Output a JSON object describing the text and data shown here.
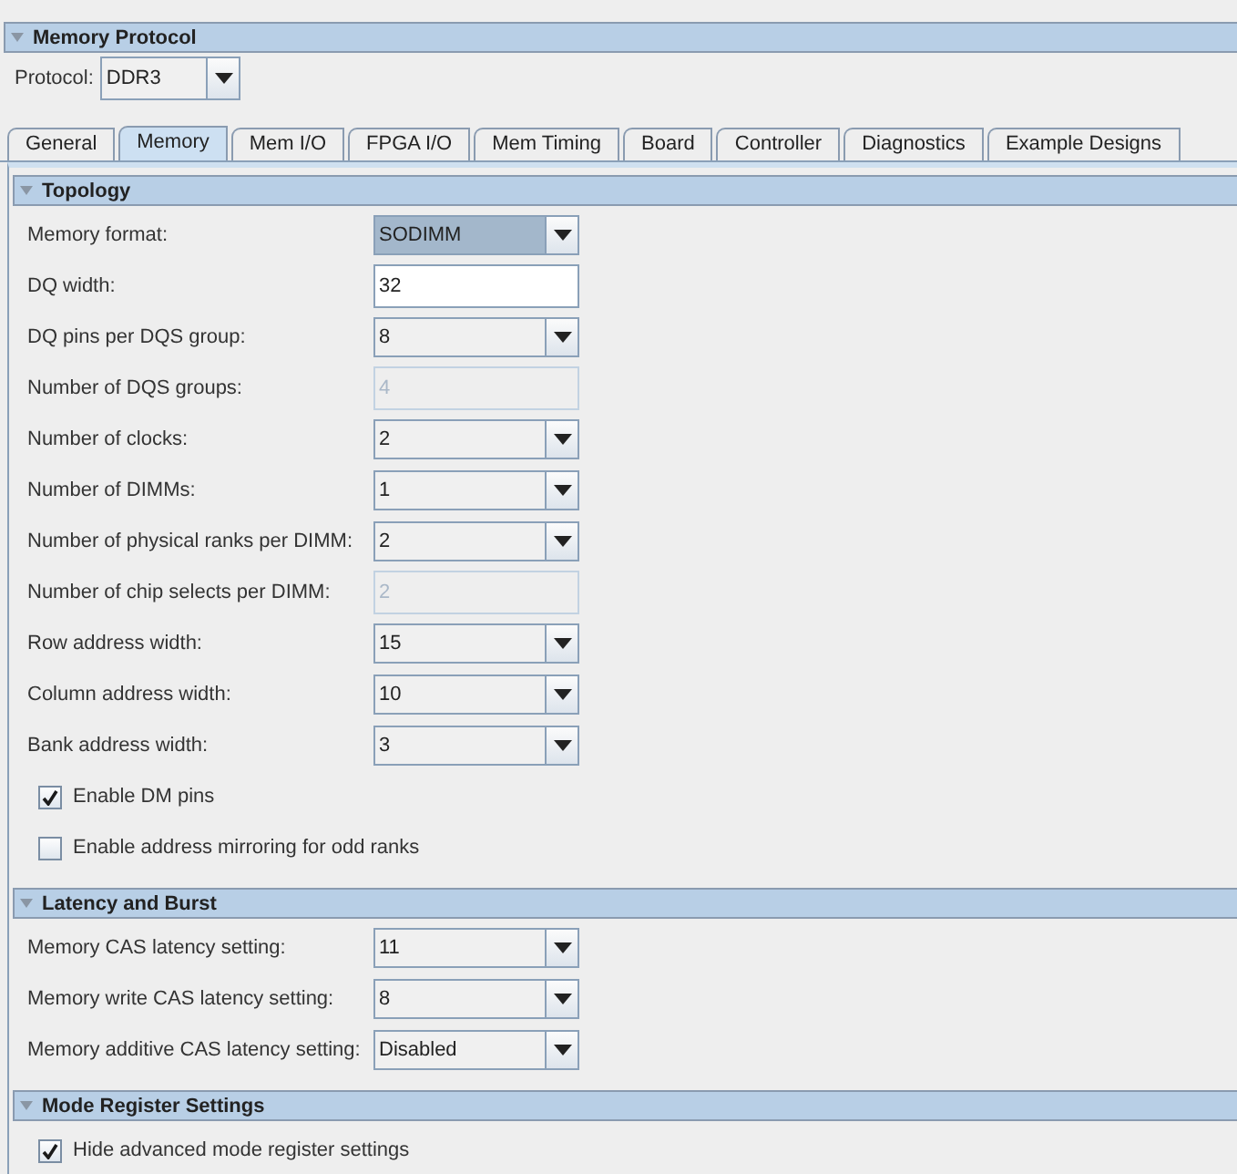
{
  "section": {
    "title": "Memory Protocol",
    "expanded": true
  },
  "protocol": {
    "label": "Protocol:",
    "value": "DDR3"
  },
  "tabs": [
    {
      "label": "General",
      "selected": false
    },
    {
      "label": "Memory",
      "selected": true
    },
    {
      "label": "Mem I/O",
      "selected": false
    },
    {
      "label": "FPGA I/O",
      "selected": false
    },
    {
      "label": "Mem Timing",
      "selected": false
    },
    {
      "label": "Board",
      "selected": false
    },
    {
      "label": "Controller",
      "selected": false
    },
    {
      "label": "Diagnostics",
      "selected": false
    },
    {
      "label": "Example Designs",
      "selected": false
    }
  ],
  "groups": [
    {
      "title": "Topology",
      "expanded": true,
      "items": [
        {
          "kind": "combo",
          "label": "Memory format:",
          "value": "SODIMM",
          "focused": true
        },
        {
          "kind": "text",
          "label": "DQ width:",
          "value": "32",
          "focused": false
        },
        {
          "kind": "combo",
          "label": "DQ pins per DQS group:",
          "value": "8",
          "focused": false
        },
        {
          "kind": "readonly",
          "label": "Number of DQS groups:",
          "value": "4",
          "focused": false
        },
        {
          "kind": "combo",
          "label": "Number of clocks:",
          "value": "2",
          "focused": false
        },
        {
          "kind": "combo",
          "label": "Number of DIMMs:",
          "value": "1",
          "focused": false
        },
        {
          "kind": "combo",
          "label": "Number of physical ranks per DIMM:",
          "value": "2",
          "focused": false
        },
        {
          "kind": "readonly",
          "label": "Number of chip selects per DIMM:",
          "value": "2",
          "focused": false
        },
        {
          "kind": "combo",
          "label": "Row address width:",
          "value": "15",
          "focused": false
        },
        {
          "kind": "combo",
          "label": "Column address width:",
          "value": "10",
          "focused": false
        },
        {
          "kind": "combo",
          "label": "Bank address width:",
          "value": "3",
          "focused": false
        },
        {
          "kind": "checkbox",
          "label": "Enable DM pins",
          "checked": true
        },
        {
          "kind": "checkbox",
          "label": "Enable address mirroring for odd ranks",
          "checked": false
        }
      ]
    },
    {
      "title": "Latency and Burst",
      "expanded": true,
      "items": [
        {
          "kind": "combo",
          "label": "Memory CAS latency setting:",
          "value": "11",
          "focused": false
        },
        {
          "kind": "combo",
          "label": "Memory write CAS latency setting:",
          "value": "8",
          "focused": false
        },
        {
          "kind": "combo",
          "label": "Memory additive CAS latency setting:",
          "value": "Disabled",
          "focused": false
        }
      ]
    },
    {
      "title": "Mode Register Settings",
      "expanded": true,
      "items": [
        {
          "kind": "checkbox",
          "label": "Hide advanced mode register settings",
          "checked": true
        }
      ]
    }
  ]
}
